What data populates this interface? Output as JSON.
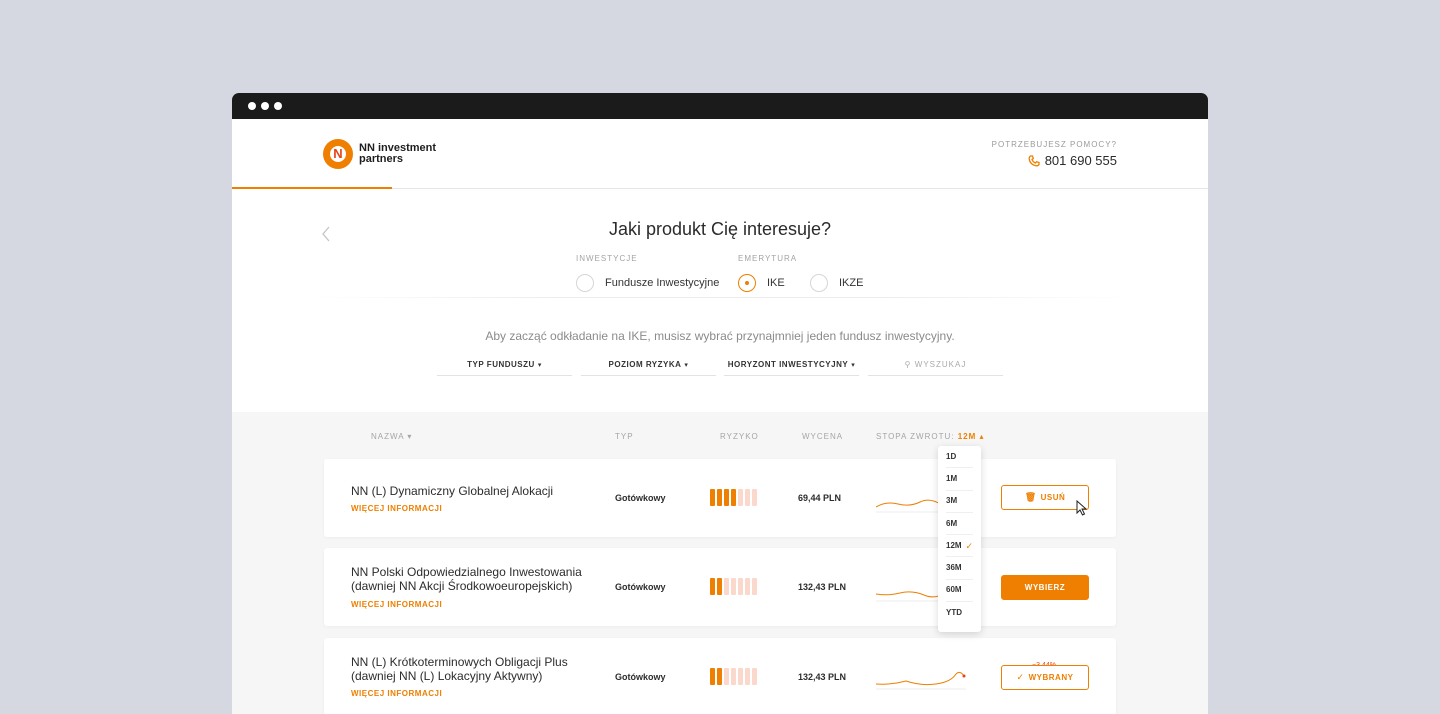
{
  "brand": {
    "logo_glyph": "N",
    "name_line1": "NN investment",
    "name_line2": "partners",
    "accent": "#ee7f00"
  },
  "help": {
    "label": "POTRZEBUJESZ POMOCY?",
    "phone": "801 690 555"
  },
  "question": {
    "title": "Jaki produkt Cię interesuje?",
    "group_investments": "INWESTYCJE",
    "group_pension": "EMERYTURA",
    "options": [
      {
        "label": "Fundusze Inwestycyjne",
        "checked": false
      },
      {
        "label": "IKE",
        "checked": true
      },
      {
        "label": "IKZE",
        "checked": false
      }
    ]
  },
  "info": "Aby zacząć odkładanie na IKE, musisz wybrać przynajmniej jeden fundusz inwestycyjny.",
  "filters": {
    "type": "TYP FUNDUSZU",
    "risk": "POZIOM RYZYKA",
    "horizon": "HORYZONT INWESTYCYJNY",
    "search_placeholder": "WYSZUKAJ"
  },
  "columns": {
    "name": "NAZWA",
    "type": "TYP",
    "risk": "RYZYKO",
    "price": "WYCENA",
    "return_label": "STOPA ZWROTU:",
    "return_period": "12M"
  },
  "funds": [
    {
      "name_line1": "NN (L) Dynamiczny Globalnej Alokacji",
      "name_line2": "",
      "more": "WIĘCEJ INFORMACJI",
      "type": "Gotówkowy",
      "risk_level": 4,
      "price": "69,44 PLN",
      "action": "USUŃ",
      "delta": ""
    },
    {
      "name_line1": "NN Polski Odpowiedzialnego Inwestowania",
      "name_line2": "(dawniej NN Akcji Środkowoeuropejskich)",
      "more": "WIĘCEJ INFORMACJI",
      "type": "Gotówkowy",
      "risk_level": 2,
      "price": "132,43 PLN",
      "action": "WYBIERZ",
      "delta": ""
    },
    {
      "name_line1": "NN (L) Krótkoterminowych Obligacji Plus",
      "name_line2": "(dawniej NN (L) Lokacyjny Aktywny)",
      "more": "WIĘCEJ INFORMACJI",
      "type": "Gotówkowy",
      "risk_level": 2,
      "price": "132,43 PLN",
      "action": "WYBRANY",
      "delta": "−3,44%"
    }
  ],
  "period_menu": [
    "1D",
    "1M",
    "3M",
    "6M",
    "12M",
    "36M",
    "60M",
    "YTD"
  ],
  "period_selected": "12M"
}
